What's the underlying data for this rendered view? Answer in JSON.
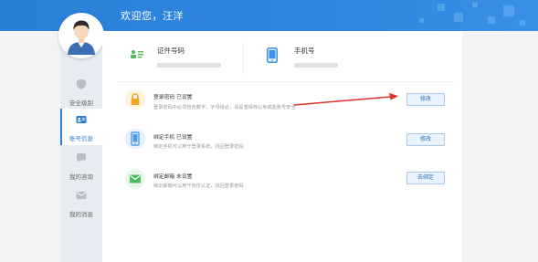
{
  "header": {
    "welcome": "欢迎您，汪洋"
  },
  "sidebar": {
    "items": [
      {
        "label": "安全级别",
        "icon": "shield-icon"
      },
      {
        "label": "账号信息",
        "icon": "id-card-icon",
        "active": true
      },
      {
        "label": "我的咨询",
        "icon": "chat-bubble-icon"
      },
      {
        "label": "我的消息",
        "icon": "envelope-icon"
      }
    ]
  },
  "account": {
    "id_title": "证件号码",
    "phone_title": "手机号"
  },
  "rows": [
    {
      "title": "登录密码 已设置",
      "desc": "登录密码中必须包含数字、字母组合，请妥善保存以免或能账号安全",
      "button": "修改",
      "icon": "lock-icon",
      "color": "#f5a623"
    },
    {
      "title": "绑定手机 已设置",
      "desc": "绑定手机可以用于登录系统，找回登录密码",
      "button": "修改",
      "icon": "mobile-icon",
      "color": "#4a9be8"
    },
    {
      "title": "绑定邮箱 未设置",
      "desc": "绑定邮箱可以用于身份认证，找回登录密码",
      "button": "去绑定",
      "icon": "mail-icon",
      "color": "#4cbb5a"
    }
  ],
  "colors": {
    "accent": "#2d7fd6",
    "arrow": "#e0302a"
  }
}
